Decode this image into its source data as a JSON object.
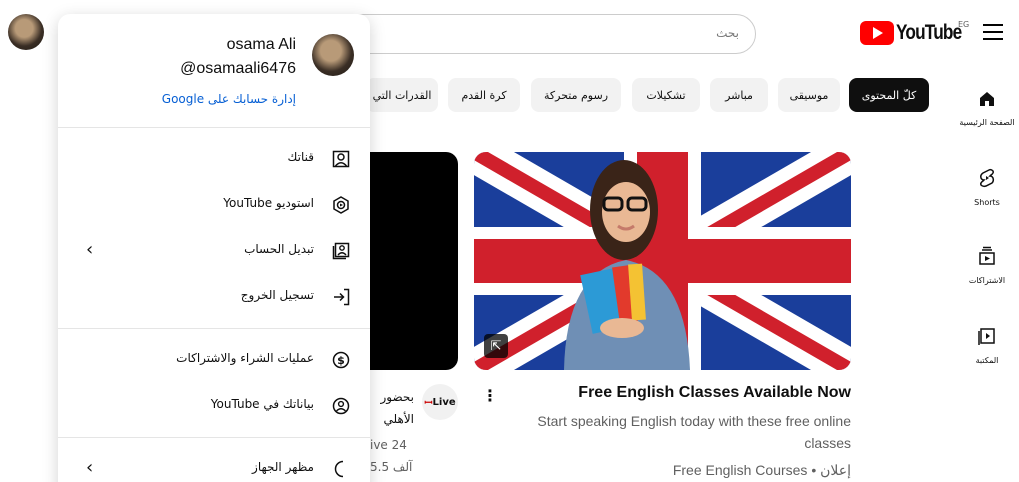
{
  "header": {
    "logo_text": "YouTube",
    "country_code": "EG",
    "search_placeholder": "بحث"
  },
  "chips": [
    {
      "label": "كلّ المحتوى",
      "active": true
    },
    {
      "label": "موسيقى",
      "active": false
    },
    {
      "label": "مباشر",
      "active": false
    },
    {
      "label": "تشكيلات",
      "active": false
    },
    {
      "label": "رسوم متحركة",
      "active": false
    },
    {
      "label": "كرة القدم",
      "active": false
    },
    {
      "label": "القدرات التي",
      "active": false
    }
  ],
  "guide": [
    {
      "label": "الصفحة الرئيسية",
      "icon": "home-icon"
    },
    {
      "label": "Shorts",
      "icon": "shorts-icon"
    },
    {
      "label": "الاشتراكات",
      "icon": "subscriptions-icon"
    },
    {
      "label": "المكتبة",
      "icon": "library-icon"
    }
  ],
  "ad_video": {
    "title": "Free English Classes Available Now",
    "description": "Start speaking English today with these free online classes",
    "meta": "Free English Courses • إعلان"
  },
  "live_video": {
    "badge": "Live",
    "title_line1": "بحضور",
    "title_line2": "الأهلي",
    "meta_line1": "ive 24",
    "meta_line2": "5.5 آلف"
  },
  "account_menu": {
    "name": "osama Ali",
    "handle": "@osamaali6476",
    "manage_label": "إدارة حسابك على Google",
    "sections": [
      [
        {
          "label": "قناتك",
          "icon": "channel-icon",
          "arrow": false
        },
        {
          "label": "استوديو YouTube",
          "icon": "studio-icon",
          "arrow": false
        },
        {
          "label": "تبديل الحساب",
          "icon": "switch-account-icon",
          "arrow": true
        },
        {
          "label": "تسجيل الخروج",
          "icon": "sign-out-icon",
          "arrow": false
        }
      ],
      [
        {
          "label": "عمليات الشراء والاشتراكات",
          "icon": "dollar-icon",
          "arrow": false
        },
        {
          "label": "بياناتك في YouTube",
          "icon": "data-icon",
          "arrow": false
        }
      ],
      [
        {
          "label": "مظهر الجهاز",
          "icon": "moon-icon",
          "arrow": true
        }
      ]
    ]
  }
}
